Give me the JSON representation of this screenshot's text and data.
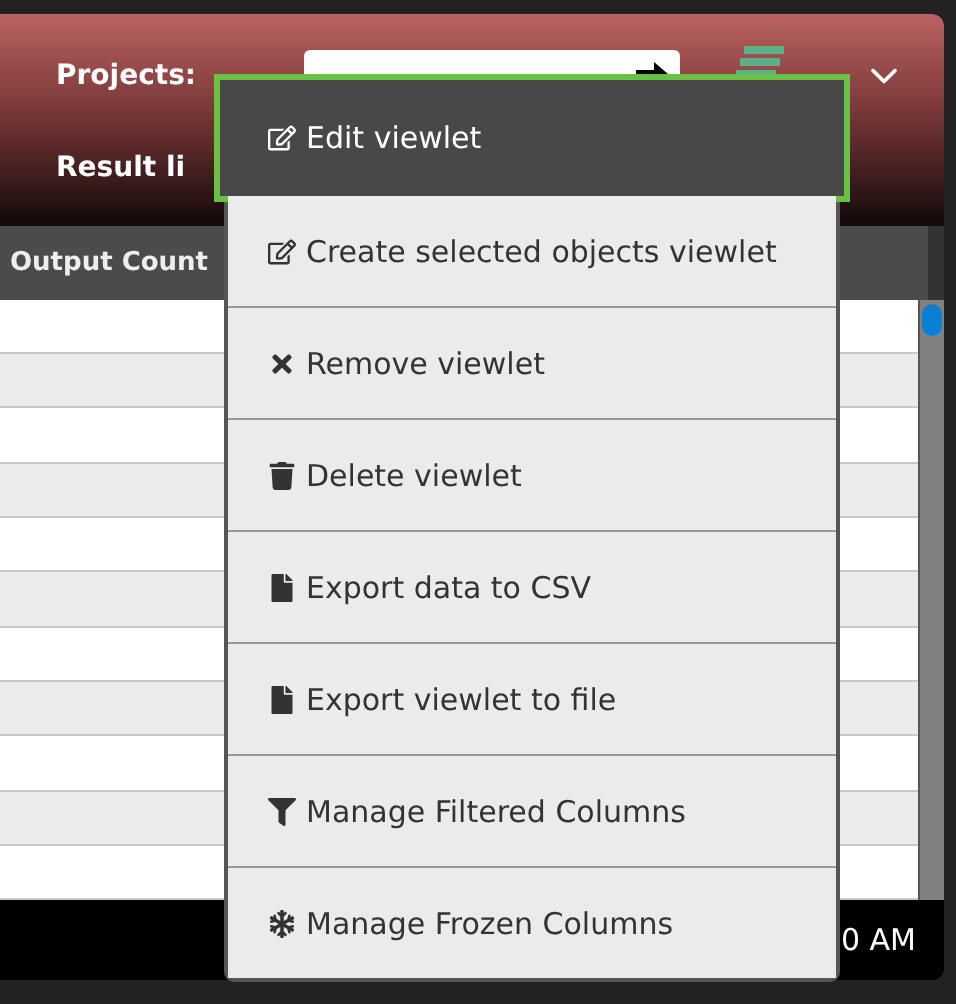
{
  "header": {
    "projects_label": "Projects:",
    "result_label": "Result li"
  },
  "table": {
    "columns": [
      "Output Count"
    ]
  },
  "footer": {
    "time": "0 AM"
  },
  "menu": [
    {
      "label": "Edit viewlet",
      "kind": "edit",
      "selected": true
    },
    {
      "label": "Create selected objects viewlet",
      "kind": "edit",
      "selected": false
    },
    {
      "label": "Remove viewlet",
      "kind": "remove",
      "selected": false
    },
    {
      "label": "Delete viewlet",
      "kind": "trash",
      "selected": false
    },
    {
      "label": "Export data to CSV",
      "kind": "file",
      "selected": false
    },
    {
      "label": "Export viewlet to file",
      "kind": "file",
      "selected": false
    },
    {
      "label": "Manage Filtered Columns",
      "kind": "filter",
      "selected": false
    },
    {
      "label": "Manage Frozen Columns",
      "kind": "snowflake",
      "selected": false
    }
  ]
}
